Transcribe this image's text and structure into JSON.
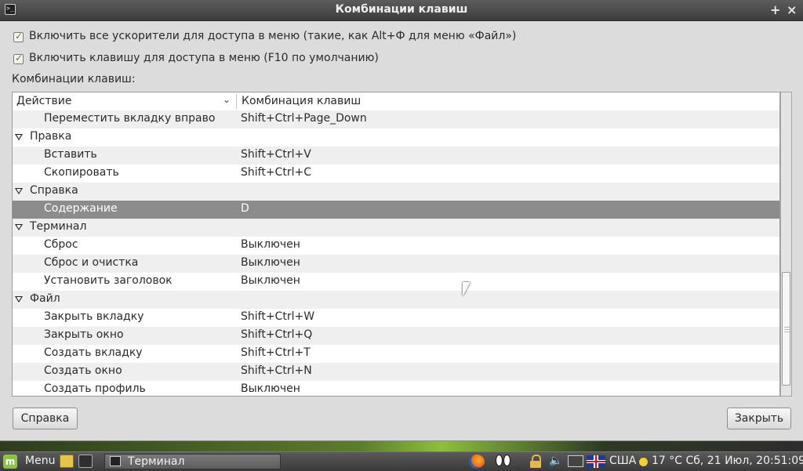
{
  "window": {
    "title": "Комбинации клавиш",
    "maximize_glyph": "+",
    "close_glyph": "×"
  },
  "options": {
    "accelerators_label": "Включить все ускорители для доступа в меню (такие, как Alt+Ф для меню «Файл»)",
    "accelerators_checked": true,
    "menu_key_label": "Включить клавишу для доступа в меню (F10 по умолчанию)",
    "menu_key_checked": true
  },
  "shortcuts_label": "Комбинации клавиш:",
  "table": {
    "col_action": "Действие",
    "col_combo": "Комбинация клавиш",
    "rows": [
      {
        "action": "Переместить вкладку вправо",
        "combo": "Shift+Ctrl+Page_Down",
        "group": false
      },
      {
        "action": "Правка",
        "combo": "",
        "group": true
      },
      {
        "action": "Вставить",
        "combo": "Shift+Ctrl+V",
        "group": false
      },
      {
        "action": "Скопировать",
        "combo": "Shift+Ctrl+C",
        "group": false
      },
      {
        "action": "Справка",
        "combo": "",
        "group": true
      },
      {
        "action": "Содержание",
        "combo": "D",
        "group": false,
        "selected": true
      },
      {
        "action": "Терминал",
        "combo": "",
        "group": true
      },
      {
        "action": "Сброс",
        "combo": "Выключен",
        "group": false
      },
      {
        "action": "Сброс и очистка",
        "combo": "Выключен",
        "group": false
      },
      {
        "action": "Установить заголовок",
        "combo": "Выключен",
        "group": false
      },
      {
        "action": "Файл",
        "combo": "",
        "group": true
      },
      {
        "action": "Закрыть вкладку",
        "combo": "Shift+Ctrl+W",
        "group": false
      },
      {
        "action": "Закрыть окно",
        "combo": "Shift+Ctrl+Q",
        "group": false
      },
      {
        "action": "Создать вкладку",
        "combo": "Shift+Ctrl+T",
        "group": false
      },
      {
        "action": "Создать окно",
        "combo": "Shift+Ctrl+N",
        "group": false
      },
      {
        "action": "Создать профиль",
        "combo": "Выключен",
        "group": false
      }
    ]
  },
  "buttons": {
    "help": "Справка",
    "close": "Закрыть"
  },
  "taskbar": {
    "menu": "Menu",
    "task_label": "Терминал",
    "layout": "США",
    "clock": "17 °C Сб, 21 Июл, 20:51:09"
  },
  "colors": {
    "selected_row": "#8c8c8c",
    "titlebar": "#4a4a4a",
    "taskbar": "#4a4a4a"
  }
}
